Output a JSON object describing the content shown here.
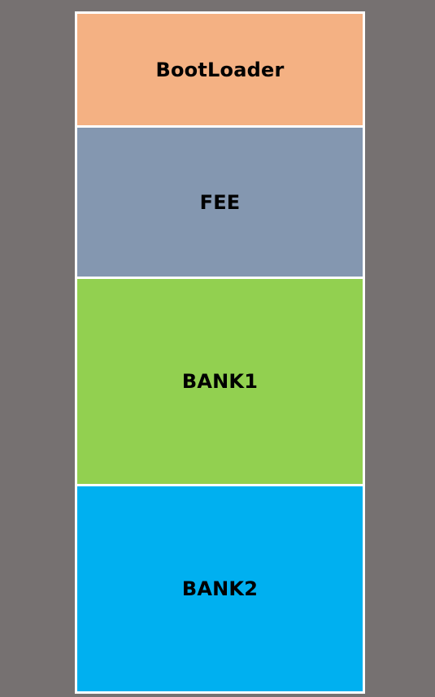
{
  "memory_map": {
    "background_color": "#767171",
    "border_color": "#FFFFFF",
    "regions": [
      {
        "label": "BootLoader",
        "color": "#F4B183"
      },
      {
        "label": "FEE",
        "color": "#8497B0"
      },
      {
        "label": "BANK1",
        "color": "#92D050"
      },
      {
        "label": "BANK2",
        "color": "#00B0F0"
      }
    ]
  }
}
